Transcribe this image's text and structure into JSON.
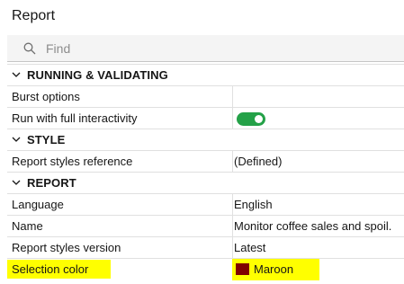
{
  "panel": {
    "title": "Report",
    "search_placeholder": "Find"
  },
  "sections": [
    {
      "label": "RUNNING & VALIDATING",
      "rows": [
        {
          "name": "Burst options",
          "value": ""
        },
        {
          "name": "Run with full interactivity",
          "toggle_on": true
        }
      ]
    },
    {
      "label": "STYLE",
      "rows": [
        {
          "name": "Report styles reference",
          "value": "(Defined)"
        }
      ]
    },
    {
      "label": "REPORT",
      "rows": [
        {
          "name": "Language",
          "value": "English"
        },
        {
          "name": "Name",
          "value": "Monitor coffee sales and spoil."
        },
        {
          "name": "Report styles version",
          "value": "Latest"
        },
        {
          "name": "Selection color",
          "value": "Maroon",
          "swatch_color": "#800000",
          "highlighted": true
        }
      ]
    }
  ],
  "colors": {
    "toggle_on": "#24a148",
    "highlight": "#ffff00",
    "maroon": "#800000"
  }
}
